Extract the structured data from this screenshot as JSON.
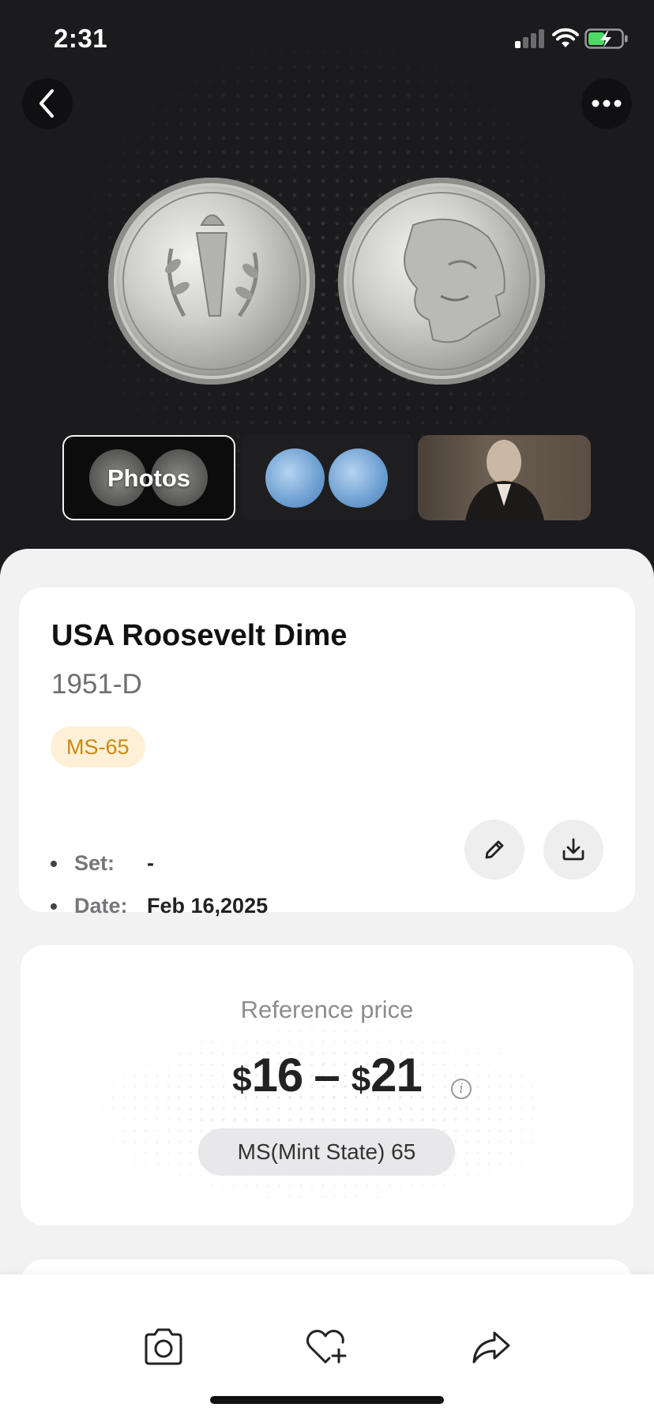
{
  "status_bar": {
    "time": "2:31"
  },
  "gallery": {
    "thumbnails": [
      {
        "label": "Photos",
        "selected": true
      },
      {
        "label": "",
        "selected": false
      },
      {
        "label": "",
        "selected": false
      }
    ]
  },
  "coin": {
    "name": "USA Roosevelt Dime",
    "year_mint": "1951-D",
    "grade": "MS-65",
    "meta": [
      {
        "key": "Set:",
        "value": "-"
      },
      {
        "key": "Date:",
        "value": "Feb 16,2025"
      }
    ]
  },
  "price": {
    "label": "Reference price",
    "currency_low": "$",
    "low": "16",
    "separator": "–",
    "currency_high": "$",
    "high": "21",
    "grade_pill": "MS(Mint State) 65"
  },
  "colors": {
    "grade_badge_bg": "#fdf0d6",
    "grade_badge_text": "#c98a12",
    "hero_bg": "#1b1b1d",
    "sheet_bg": "#f2f2f3"
  },
  "icons": {
    "back": "chevron-left-icon",
    "more": "ellipsis-icon",
    "edit": "pencil-icon",
    "download": "download-icon",
    "camera": "camera-icon",
    "favorite": "heart-plus-icon",
    "share": "share-arrow-icon",
    "info": "info-icon"
  }
}
